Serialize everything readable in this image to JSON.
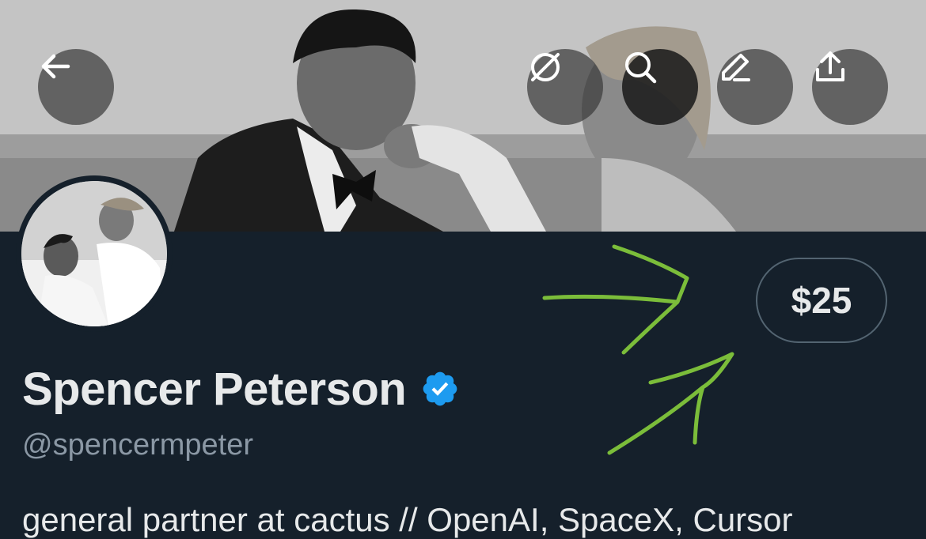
{
  "banner": {
    "description_icon": "wedding-photo-banner"
  },
  "toolbar": {
    "back_icon": "arrow-left-icon",
    "buttons": [
      {
        "icon": "sparkle-off-icon"
      },
      {
        "icon": "search-icon"
      },
      {
        "icon": "pen-icon"
      },
      {
        "icon": "share-icon"
      }
    ]
  },
  "profile": {
    "price_label": "$25",
    "display_name": "Spencer Peterson",
    "handle": "@spencermpeter",
    "bio": "general partner at cactus // OpenAI, SpaceX, Cursor",
    "verified_color": "#1d9bf0"
  },
  "colors": {
    "background": "#15202b",
    "annotation": "#7bbd3a",
    "text_primary": "#e7e9ea",
    "text_secondary": "#8b98a5"
  }
}
